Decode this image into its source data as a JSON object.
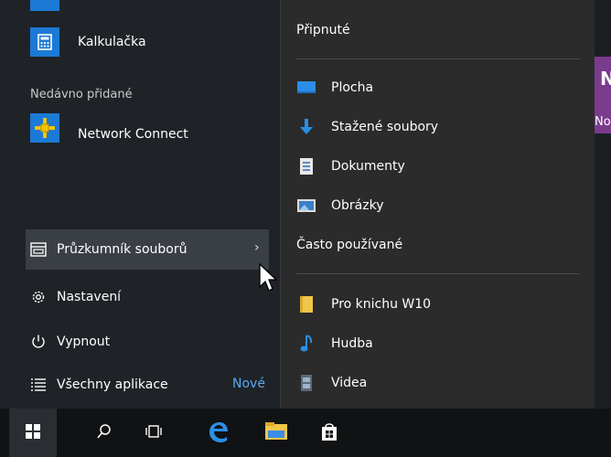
{
  "left_panel": {
    "apps": [
      {
        "label": "Kalkulačka",
        "icon": "calculator-icon"
      }
    ],
    "recent_header": "Nedávno přidané",
    "recent_apps": [
      {
        "label": "Network Connect",
        "icon": "network-connect-icon"
      }
    ],
    "menu": {
      "file_explorer": "Průzkumník souborů",
      "settings": "Nastavení",
      "power": "Vypnout",
      "all_apps": "Všechny aplikace",
      "all_apps_badge": "Nové"
    }
  },
  "jump_list": {
    "pinned_header": "Připnuté",
    "pinned_items": [
      {
        "label": "Plocha",
        "icon": "desktop-icon"
      },
      {
        "label": "Stažené soubory",
        "icon": "download-icon"
      },
      {
        "label": "Dokumenty",
        "icon": "document-icon"
      },
      {
        "label": "Obrázky",
        "icon": "pictures-icon"
      }
    ],
    "frequent_header": "Často používané",
    "frequent_items": [
      {
        "label": "Pro knichu W10",
        "icon": "folder-icon"
      },
      {
        "label": "Hudba",
        "icon": "music-icon"
      },
      {
        "label": "Videa",
        "icon": "video-icon"
      }
    ]
  },
  "tile_partial": {
    "letter": "N",
    "label": "No"
  },
  "taskbar": {
    "buttons": [
      "start-icon",
      "search-icon",
      "task-view-icon",
      "edge-icon",
      "file-explorer-icon",
      "store-icon"
    ]
  },
  "colors": {
    "accent": "#1b7ad6",
    "onenote": "#7a3b8c",
    "folder": "#f0c64a",
    "badge": "#5aa7f0"
  }
}
